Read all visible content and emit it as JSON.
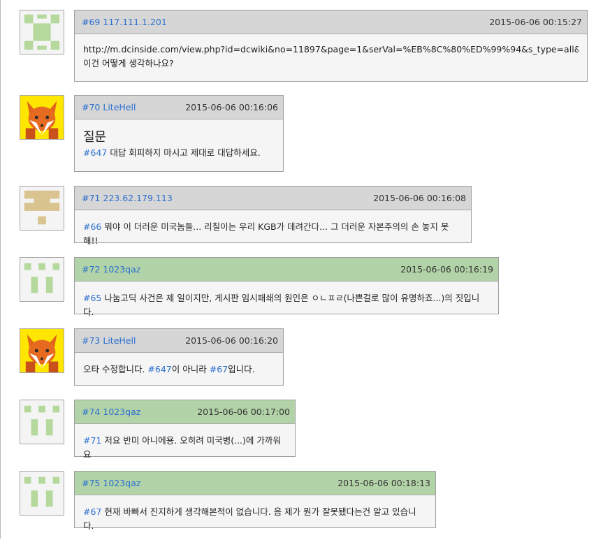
{
  "comments": [
    {
      "number": "#69",
      "author": "117.111.1.201",
      "time": "2015-06-06 00:15:27",
      "avatar": "identicon-green-x",
      "header_color": "gray",
      "lines": [
        "http://m.dcinside.com/view.php?id=dcwiki&no=11897&page=1&serVal=%EB%8C%80%ED%99%94&s_type=all&ser_pos=",
        "이건 어떻게 생각하나요?"
      ]
    },
    {
      "number": "#70",
      "author": "LiteHell",
      "time": "2015-06-06 00:16:06",
      "avatar": "fox",
      "header_color": "gray",
      "title": "질문",
      "ref": "#647",
      "text": " 대답 회피하지 마시고 제대로 대답하세요."
    },
    {
      "number": "#71",
      "author": "223.62.179.113",
      "time": "2015-06-06 00:16:08",
      "avatar": "identicon-tan",
      "header_color": "gray",
      "ref": "#66",
      "text": " 뭐야 이 더러운 미국놈들... 리칠이는 우리 KGB가 데려간다... 그 더러운 자본주의의 손 놓지 못해!!"
    },
    {
      "number": "#72",
      "author": "1023qaz",
      "time": "2015-06-06 00:16:19",
      "avatar": "identicon-green-bars",
      "header_color": "green",
      "ref": "#65",
      "text": " 나눔고딕 사건은 제 일이지만, 게시판 임시패쇄의 원인은 ㅇㄴㅍㄹ(나쁜걸로 많이 유명하죠...)의 짓입니다."
    },
    {
      "number": "#73",
      "author": "LiteHell",
      "time": "2015-06-06 00:16:20",
      "avatar": "fox",
      "header_color": "gray",
      "pre": "오타 수정합니다. ",
      "ref": "#647",
      "mid": "이 아니라 ",
      "ref2": "#67",
      "post": "입니다."
    },
    {
      "number": "#74",
      "author": "1023qaz",
      "time": "2015-06-06 00:17:00",
      "avatar": "identicon-green-bars",
      "header_color": "green",
      "ref": "#71",
      "text": " 저요 반미 아니에용. 오히려 미국병(...)에 가까워요"
    },
    {
      "number": "#75",
      "author": "1023qaz",
      "time": "2015-06-06 00:18:13",
      "avatar": "identicon-green-bars",
      "header_color": "green",
      "ref": "#67",
      "text": " 현재 바빠서 진지하게 생각해본적이 없습니다. 음 제가 뭔가 잘못됐다는건 알고 있습니다."
    }
  ],
  "colors": {
    "header_gray": "#d6d6d6",
    "header_green": "#b2d3a8",
    "link_blue": "#2b6fcf",
    "identicon_green": "#b5d99c",
    "identicon_tan": "#d9c38f"
  }
}
